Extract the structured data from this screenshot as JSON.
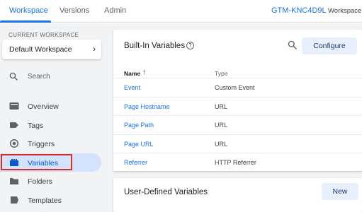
{
  "topbar": {
    "tabs": [
      {
        "label": "Workspace",
        "active": true
      },
      {
        "label": "Versions",
        "active": false
      },
      {
        "label": "Admin",
        "active": false
      }
    ],
    "container_id": "GTM-KNC4D9L",
    "workspace_short": "Workspace"
  },
  "sidebar": {
    "current_workspace_label": "CURRENT WORKSPACE",
    "workspace_name": "Default Workspace",
    "search_label": "Search",
    "items": [
      {
        "label": "Overview",
        "icon": "overview-icon"
      },
      {
        "label": "Tags",
        "icon": "tag-icon"
      },
      {
        "label": "Triggers",
        "icon": "trigger-icon"
      },
      {
        "label": "Variables",
        "icon": "variables-icon",
        "selected": true
      },
      {
        "label": "Folders",
        "icon": "folder-icon"
      },
      {
        "label": "Templates",
        "icon": "template-icon"
      }
    ]
  },
  "builtin": {
    "title": "Built-In Variables",
    "help": "?",
    "configure_label": "Configure",
    "columns": {
      "name": "Name",
      "type": "Type"
    },
    "rows": [
      {
        "name": "Event",
        "type": "Custom Event"
      },
      {
        "name": "Page Hostname",
        "type": "URL"
      },
      {
        "name": "Page Path",
        "type": "URL"
      },
      {
        "name": "Page URL",
        "type": "URL"
      },
      {
        "name": "Referrer",
        "type": "HTTP Referrer"
      }
    ]
  },
  "userdefined": {
    "title": "User-Defined Variables",
    "new_label": "New"
  },
  "colors": {
    "accent": "#1a73e8",
    "selected_bg": "#d3e3fd",
    "highlight": "#d93025"
  }
}
